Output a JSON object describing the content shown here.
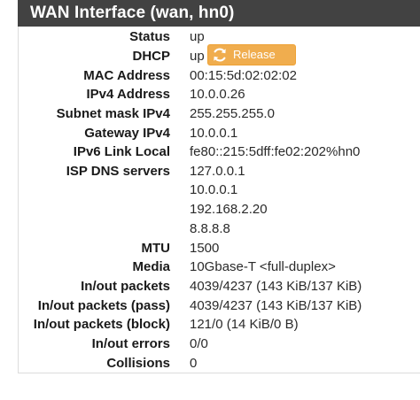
{
  "panel": {
    "title": "WAN Interface (wan, hn0)"
  },
  "rows": [
    {
      "label": "Status",
      "value": "up"
    },
    {
      "label": "DHCP",
      "value": "up",
      "button": "Release"
    },
    {
      "label": "MAC Address",
      "value": "00:15:5d:02:02:02"
    },
    {
      "label": "IPv4 Address",
      "value": "10.0.0.26"
    },
    {
      "label": "Subnet mask IPv4",
      "value": "255.255.255.0"
    },
    {
      "label": "Gateway IPv4",
      "value": "10.0.0.1"
    },
    {
      "label": "IPv6 Link Local",
      "value": "fe80::215:5dff:fe02:202%hn0"
    },
    {
      "label": "ISP DNS servers",
      "values": [
        "127.0.0.1",
        "10.0.0.1",
        "192.168.2.20",
        "8.8.8.8"
      ]
    },
    {
      "label": "MTU",
      "value": "1500"
    },
    {
      "label": "Media",
      "value": "10Gbase-T <full-duplex>"
    },
    {
      "label": "In/out packets",
      "value": "4039/4237 (143 KiB/137 KiB)"
    },
    {
      "label": "In/out packets (pass)",
      "value": "4039/4237 (143 KiB/137 KiB)"
    },
    {
      "label": "In/out packets (block)",
      "value": "121/0 (14 KiB/0 B)"
    },
    {
      "label": "In/out errors",
      "value": "0/0"
    },
    {
      "label": "Collisions",
      "value": "0"
    }
  ],
  "colors": {
    "header_bg": "#424242",
    "button_bg": "#f0ad4e"
  },
  "icons": {
    "release": "refresh-icon"
  }
}
